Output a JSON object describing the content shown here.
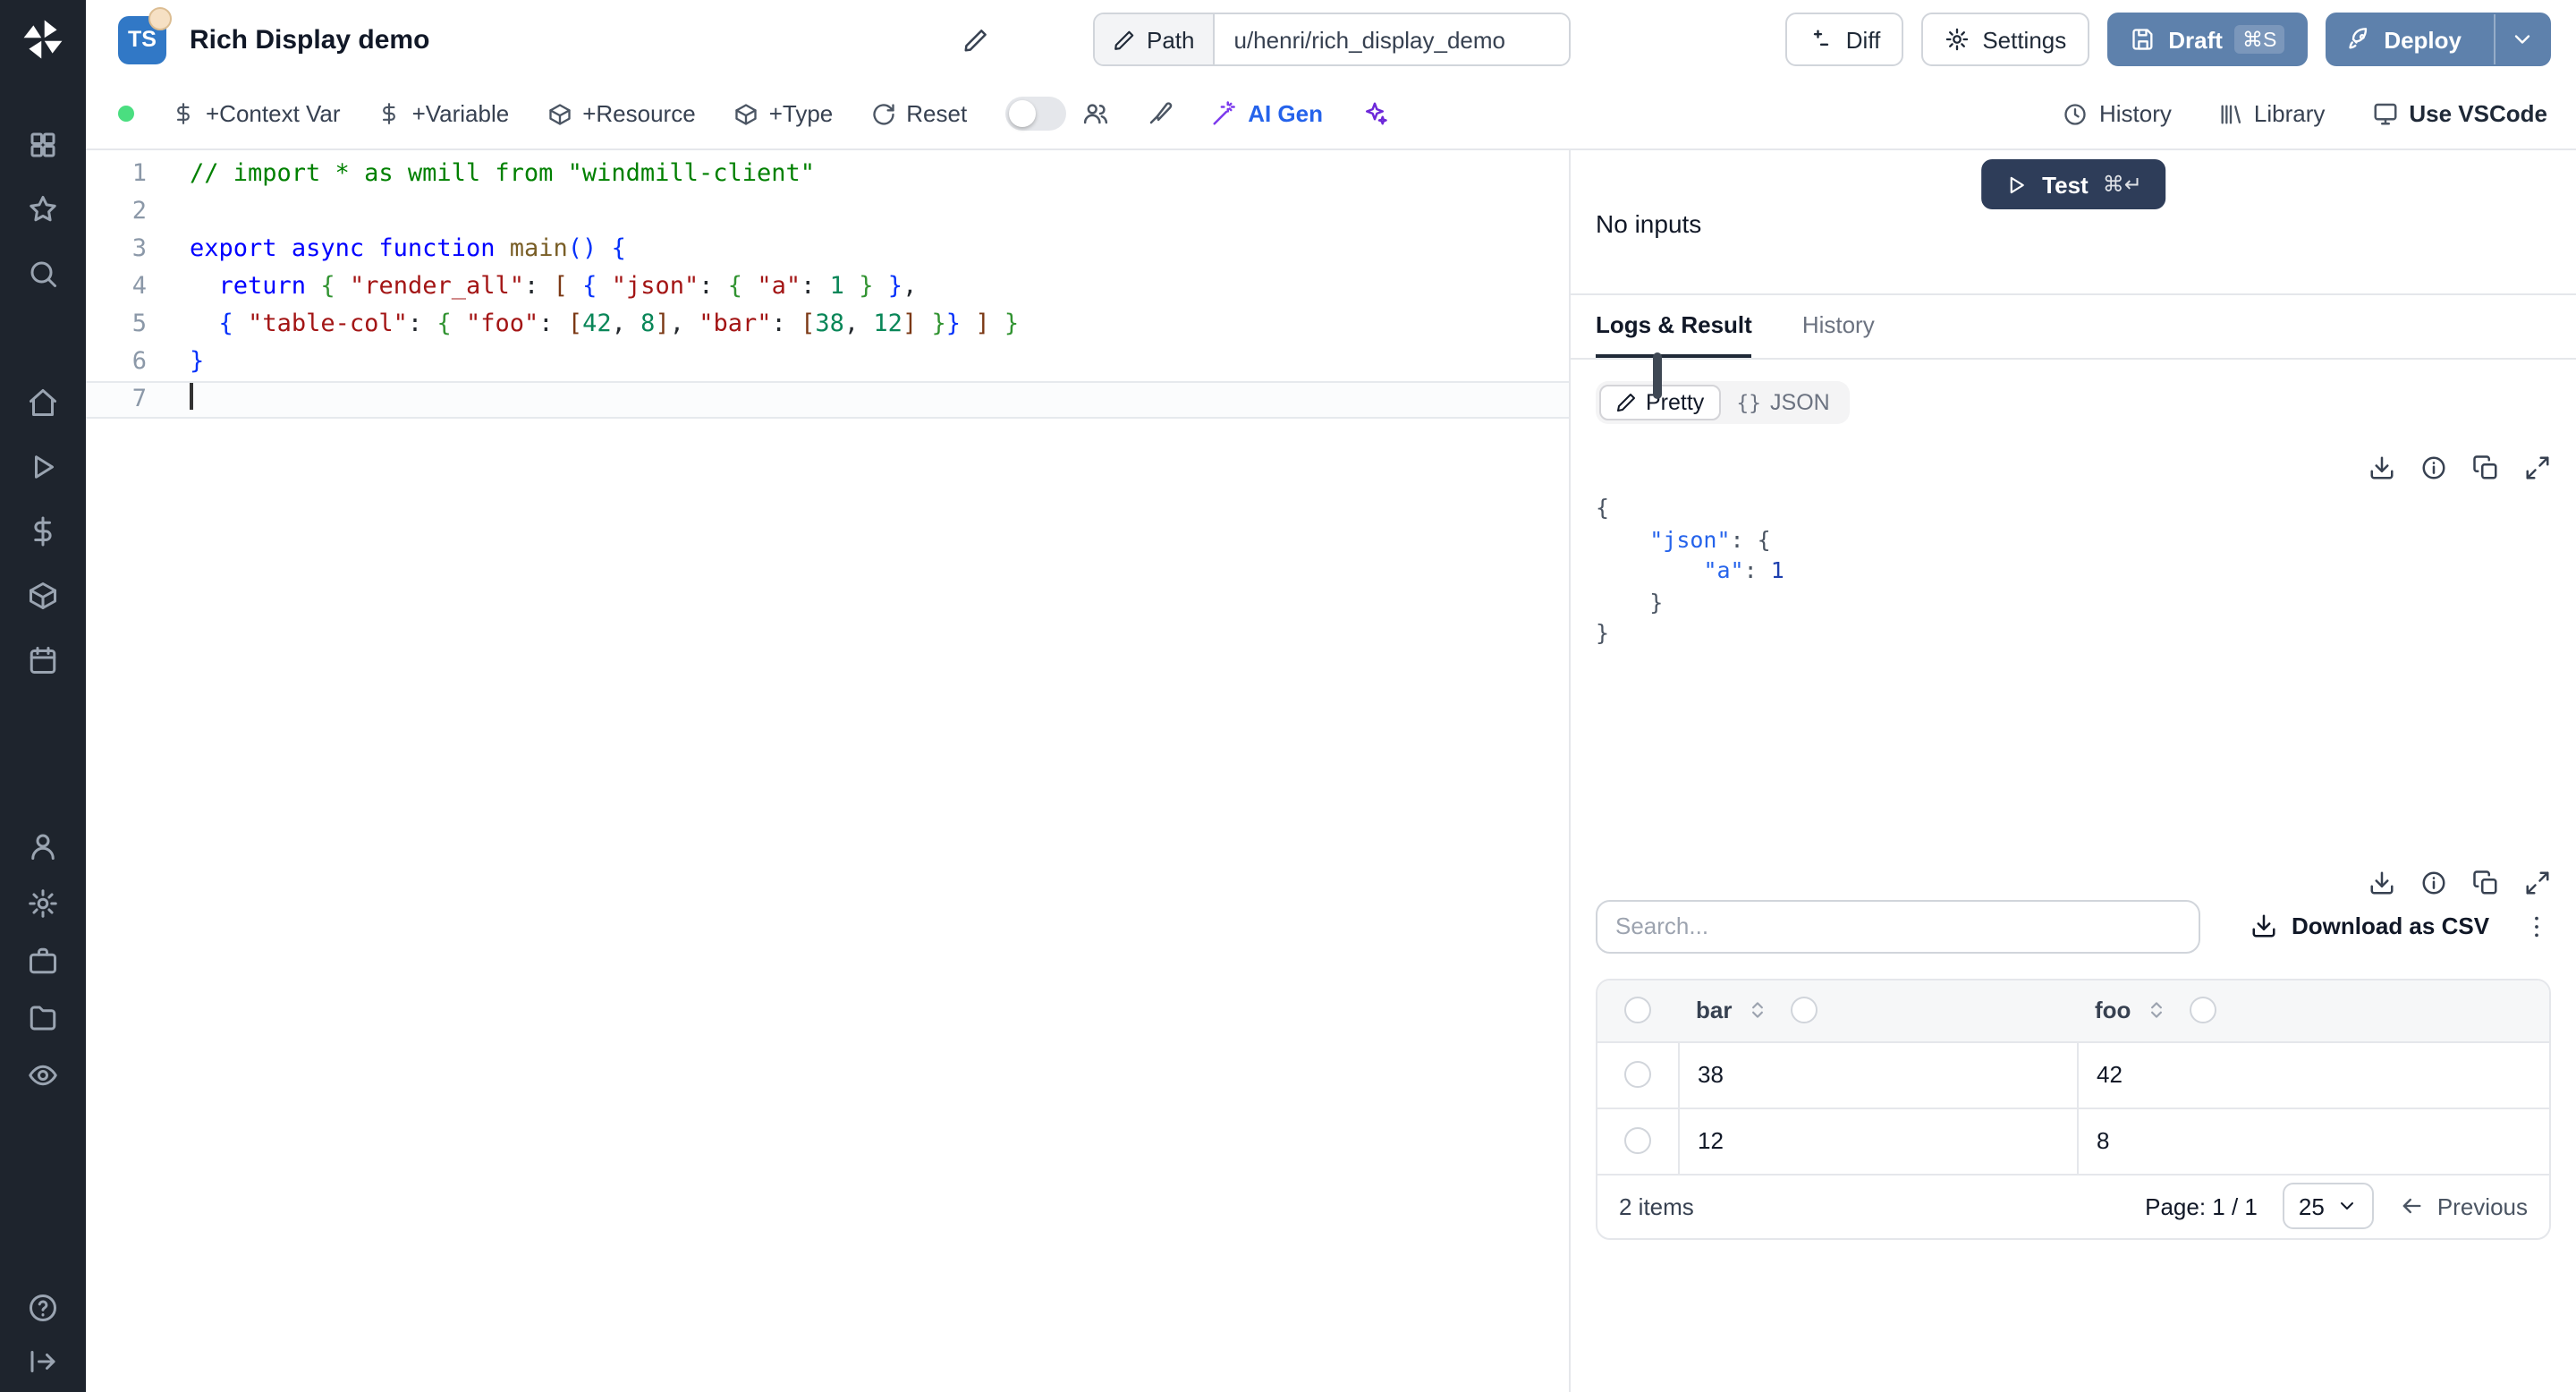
{
  "header": {
    "lang_badge": "TS",
    "title": "Rich Display demo",
    "path_label": "Path",
    "path_value": "u/henri/rich_display_demo",
    "diff_label": "Diff",
    "settings_label": "Settings",
    "draft_label": "Draft",
    "draft_kbd": "⌘S",
    "deploy_label": "Deploy"
  },
  "toolbar": {
    "context_var": "+Context Var",
    "variable": "+Variable",
    "resource": "+Resource",
    "type": "+Type",
    "reset": "Reset",
    "ai_gen": "AI Gen",
    "history": "History",
    "library": "Library",
    "vscode": "Use VSCode"
  },
  "editor": {
    "lines": [
      [
        [
          "c",
          "// import * as wmill from \"windmill-client\""
        ]
      ],
      [],
      [
        [
          "k",
          "export"
        ],
        [
          "p",
          " "
        ],
        [
          "k",
          "async"
        ],
        [
          "p",
          " "
        ],
        [
          "k",
          "function"
        ],
        [
          "p",
          " "
        ],
        [
          "f",
          "main"
        ],
        [
          "b1",
          "()"
        ],
        [
          "p",
          " "
        ],
        [
          "b1",
          "{"
        ]
      ],
      [
        [
          "p",
          "  "
        ],
        [
          "k",
          "return"
        ],
        [
          "p",
          " "
        ],
        [
          "b2",
          "{"
        ],
        [
          "p",
          " "
        ],
        [
          "s",
          "\"render_all\""
        ],
        [
          "p",
          ": "
        ],
        [
          "b3",
          "["
        ],
        [
          "p",
          " "
        ],
        [
          "b1",
          "{"
        ],
        [
          "p",
          " "
        ],
        [
          "s",
          "\"json\""
        ],
        [
          "p",
          ": "
        ],
        [
          "b2",
          "{"
        ],
        [
          "p",
          " "
        ],
        [
          "s",
          "\"a\""
        ],
        [
          "p",
          ": "
        ],
        [
          "n",
          "1"
        ],
        [
          "p",
          " "
        ],
        [
          "b2",
          "}"
        ],
        [
          "p",
          " "
        ],
        [
          "b1",
          "}"
        ],
        [
          "p",
          ","
        ]
      ],
      [
        [
          "p",
          "  "
        ],
        [
          "b1",
          "{"
        ],
        [
          "p",
          " "
        ],
        [
          "s",
          "\"table-col\""
        ],
        [
          "p",
          ": "
        ],
        [
          "b2",
          "{"
        ],
        [
          "p",
          " "
        ],
        [
          "s",
          "\"foo\""
        ],
        [
          "p",
          ": "
        ],
        [
          "b3",
          "["
        ],
        [
          "n",
          "42"
        ],
        [
          "p",
          ", "
        ],
        [
          "n",
          "8"
        ],
        [
          "b3",
          "]"
        ],
        [
          "p",
          ", "
        ],
        [
          "s",
          "\"bar\""
        ],
        [
          "p",
          ": "
        ],
        [
          "b3",
          "["
        ],
        [
          "n",
          "38"
        ],
        [
          "p",
          ", "
        ],
        [
          "n",
          "12"
        ],
        [
          "b3",
          "]"
        ],
        [
          "p",
          " "
        ],
        [
          "b2",
          "}"
        ],
        [
          "b1",
          "}"
        ],
        [
          "p",
          " "
        ],
        [
          "b3",
          "]"
        ],
        [
          "p",
          " "
        ],
        [
          "b2",
          "}"
        ]
      ],
      [
        [
          "b1",
          "}"
        ]
      ],
      []
    ]
  },
  "right": {
    "test_label": "Test",
    "test_kbd": "⌘↵",
    "no_inputs": "No inputs",
    "tab_logs": "Logs & Result",
    "tab_history": "History",
    "pretty_label": "Pretty",
    "json_braces": "{}",
    "json_label": "JSON",
    "result_json_lines": [
      [
        [
          "p",
          "{"
        ]
      ],
      [
        [
          "p",
          "    "
        ],
        [
          "key",
          "\"json\""
        ],
        [
          "p",
          ": {"
        ]
      ],
      [
        [
          "p",
          "        "
        ],
        [
          "key",
          "\"a\""
        ],
        [
          "p",
          ": "
        ],
        [
          "num",
          "1"
        ]
      ],
      [
        [
          "p",
          "    }"
        ]
      ],
      [
        [
          "p",
          "}"
        ]
      ]
    ],
    "table": {
      "search_placeholder": "Search...",
      "download_csv": "Download as CSV",
      "columns": [
        "bar",
        "foo"
      ],
      "rows": [
        [
          "38",
          "42"
        ],
        [
          "12",
          "8"
        ]
      ],
      "items_label": "2 items",
      "page_label": "Page: 1 / 1",
      "page_size": "25",
      "previous_label": "Previous"
    }
  },
  "colors": {
    "accent_blue": "#5e81ac",
    "test_button": "#2e3d59",
    "sidebar_bg": "#1e242d",
    "status_green": "#4ade80",
    "ts_badge": "#3178c6"
  }
}
